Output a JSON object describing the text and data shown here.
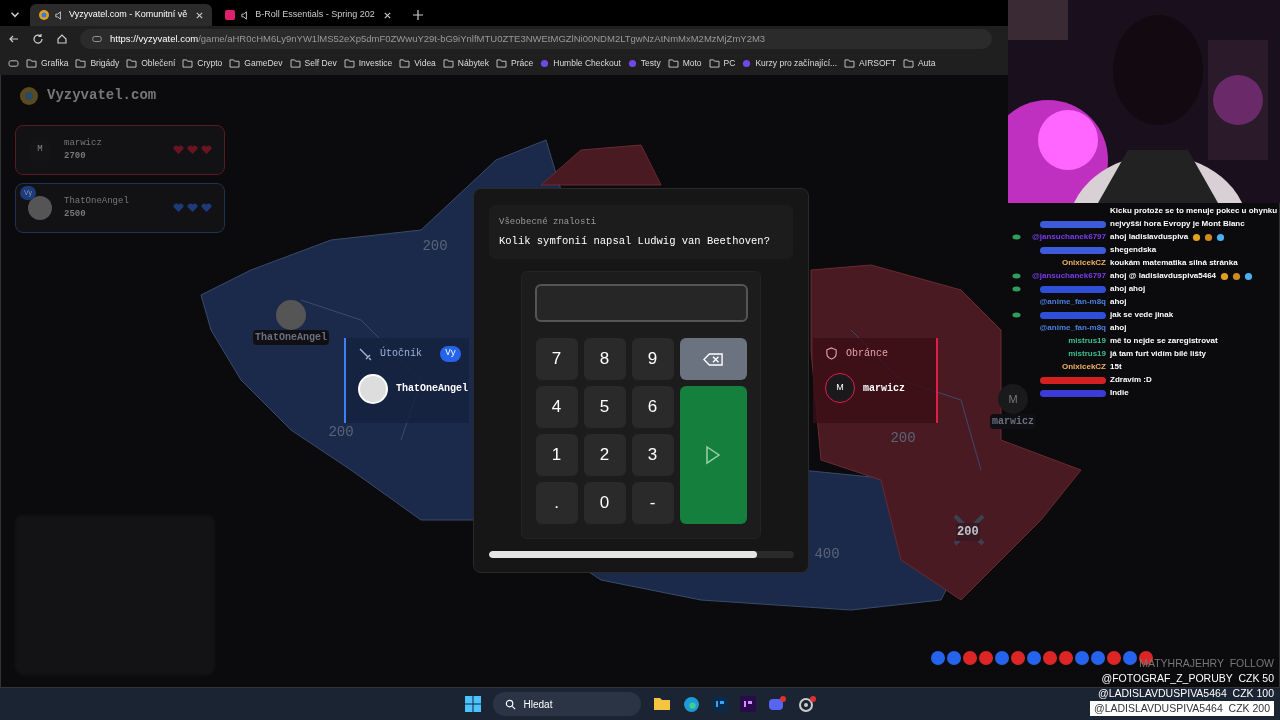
{
  "browser": {
    "tabs": [
      {
        "title": "Vyzyvatel.com - Komunitní vě",
        "selected": true
      },
      {
        "title": "B-Roll Essentials - Spring 202",
        "selected": false
      }
    ],
    "url_host": "https://vyzyvatel.com",
    "url_path": "/game/aHR0cHM6Ly9nYW1lMS52eXp5dmF0ZWwuY29t-bG9iYnlfMTU0ZTE3NWEtMGZlNi00NDM2LTgwNzAtNmMxM2MzMjZmY2M3",
    "bookmarks": [
      {
        "label": "Grafika",
        "kind": "folder"
      },
      {
        "label": "Brigády",
        "kind": "folder"
      },
      {
        "label": "Oblečení",
        "kind": "folder"
      },
      {
        "label": "Crypto",
        "kind": "folder"
      },
      {
        "label": "GameDev",
        "kind": "folder"
      },
      {
        "label": "Self Dev",
        "kind": "folder"
      },
      {
        "label": "Investice",
        "kind": "folder"
      },
      {
        "label": "Videa",
        "kind": "folder"
      },
      {
        "label": "Nábytek",
        "kind": "folder"
      },
      {
        "label": "Práce",
        "kind": "folder"
      },
      {
        "label": "Humble Checkout",
        "kind": "site"
      },
      {
        "label": "Testy",
        "kind": "site"
      },
      {
        "label": "Moto",
        "kind": "folder"
      },
      {
        "label": "PC",
        "kind": "folder"
      },
      {
        "label": "Kurzy pro začínající...",
        "kind": "site"
      },
      {
        "label": "AIRSOFT",
        "kind": "folder"
      },
      {
        "label": "Auta",
        "kind": "folder"
      }
    ]
  },
  "game": {
    "logo": "Vyzyvatel.com",
    "players": [
      {
        "name": "marwicz",
        "score": "2700",
        "color": "#5a1a22",
        "avatar": "M",
        "you": false
      },
      {
        "name": "ThatOneAngel",
        "score": "2500",
        "color": "#1e3358",
        "you": true,
        "you_label": "Vy"
      }
    ],
    "map_labels": [
      "200",
      "200",
      "200",
      "400"
    ],
    "swords_label": "200",
    "markers": [
      {
        "name": "ThatOneAngel",
        "color": "#555555"
      },
      {
        "name": "marwicz",
        "color": "#1a1a1c",
        "avatar": "M"
      }
    ],
    "attacker": {
      "role": "Útočník",
      "badge": "Vy",
      "name": "ThatOneAngel"
    },
    "defender": {
      "role": "Obránce",
      "avatar": "M",
      "name": "marwicz"
    },
    "question": {
      "category": "Všeobecné znalosti",
      "text": "Kolik symfonií napsal Ludwig van Beethoven?"
    },
    "keypad": [
      "7",
      "8",
      "9",
      "4",
      "5",
      "6",
      "1",
      "2",
      "3",
      ".",
      "0",
      "-"
    ],
    "timer": {
      "level": 0.88
    },
    "rounds": [
      {
        "color": "#2563eb"
      },
      {
        "color": "#2563eb"
      },
      {
        "color": "#dc2626"
      },
      {
        "color": "#dc2626"
      },
      {
        "color": "#2563eb"
      },
      {
        "color": "#dc2626"
      },
      {
        "color": "#2563eb"
      },
      {
        "color": "#dc2626"
      },
      {
        "color": "#dc2626"
      },
      {
        "color": "#2563eb"
      },
      {
        "color": "#2563eb"
      },
      {
        "color": "#dc2626"
      },
      {
        "color": "#2563eb"
      },
      {
        "color": "#dc2626"
      }
    ]
  },
  "chat": [
    {
      "kind": "continuation",
      "text": "Kicku protože se to menuje pokec u ohynku"
    },
    {
      "kind": "blurred",
      "color": "#3b5bdb",
      "badge": false,
      "text": "nejvyšší hora Evropy je Mont Blanc"
    },
    {
      "kind": "named",
      "user": "@jansuchanek6797",
      "color": "#7c3aed",
      "badge": true,
      "text": "ahoj ladislavduspiva",
      "emotes": true
    },
    {
      "kind": "blurred",
      "color": "#3b5bdb",
      "badge": false,
      "text": "shegendska"
    },
    {
      "kind": "named",
      "user": "OnixicekCZ",
      "color": "#f0b060",
      "badge": false,
      "text": "koukám matematika silná stránka"
    },
    {
      "kind": "named",
      "user": "@jansuchanek6797",
      "color": "#7c3aed",
      "badge": true,
      "text": "ahoj @ ladislavduspiva5464",
      "emotes": true
    },
    {
      "kind": "blurred",
      "color": "#2f4fd8",
      "badge": true,
      "text": "ahoj ahoj"
    },
    {
      "kind": "named",
      "user": "@anime_fan-m8q",
      "color": "#4a7fe0",
      "badge": false,
      "text": "ahoj"
    },
    {
      "kind": "blurred",
      "color": "#2f4fd8",
      "badge": true,
      "text": "jak se vede jinak"
    },
    {
      "kind": "named",
      "user": "@anime_fan-m8q",
      "color": "#4a7fe0",
      "badge": false,
      "text": "ahoj"
    },
    {
      "kind": "named",
      "user": "mistrus19",
      "color": "#3fbf8f",
      "badge": false,
      "text": "mě to nejde se zaregistrovat"
    },
    {
      "kind": "named",
      "user": "mistrus19",
      "color": "#3fbf8f",
      "badge": false,
      "text": "já tam furt vidím bílé lišty"
    },
    {
      "kind": "named",
      "user": "OnixicekCZ",
      "color": "#f0b060",
      "badge": false,
      "text": "15t"
    },
    {
      "kind": "blurred",
      "color": "#d42020",
      "badge": false,
      "text": "Zdravím :D"
    },
    {
      "kind": "blurred",
      "color": "#3b3bd8",
      "badge": false,
      "text": "Indie"
    }
  ],
  "alerts": [
    {
      "text": "MATYHRAJEHRY  FOLLOW",
      "kind": "dim"
    },
    {
      "text": "@FOTOGRAF_Z_PORUBY  CZK 50",
      "kind": "plain"
    },
    {
      "text": "@LADISLAVDUSPIVA5464  CZK 100",
      "kind": "plain"
    },
    {
      "text": "@LADISLAVDUSPIVA5464  CZK 200",
      "kind": "boxed"
    }
  ],
  "taskbar": {
    "search": "Hledat"
  }
}
